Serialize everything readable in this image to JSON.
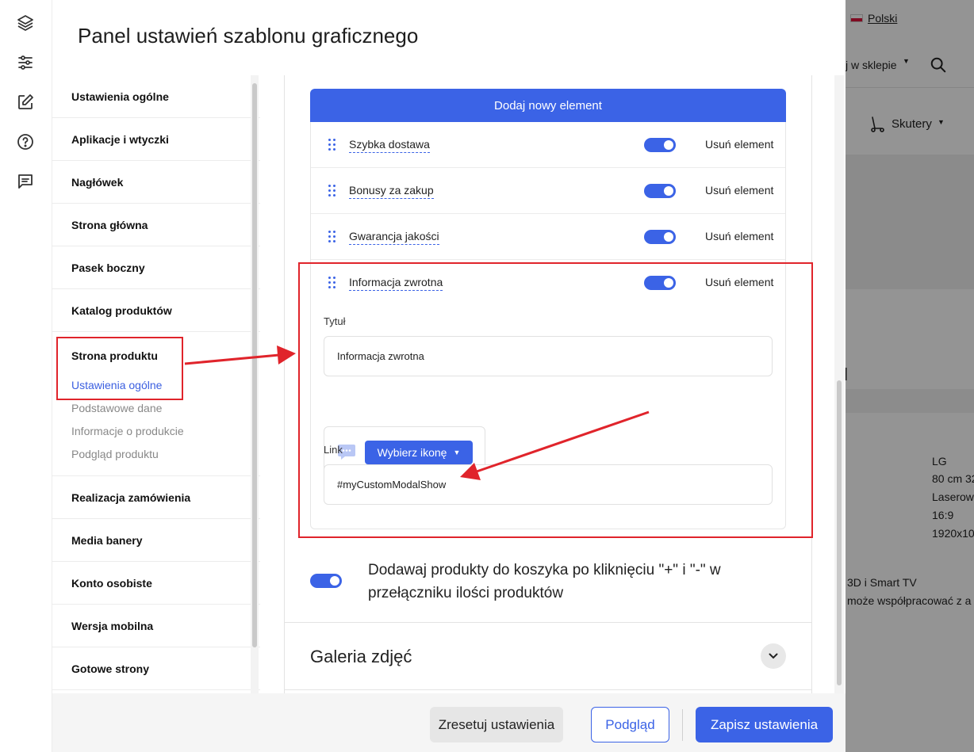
{
  "panel": {
    "title": "Panel ustawień szablonu graficznego"
  },
  "rail_icons": [
    "layers-icon",
    "sliders-icon",
    "edit-icon",
    "help-icon",
    "message-icon"
  ],
  "nav": {
    "items": [
      {
        "label": "Ustawienia ogólne"
      },
      {
        "label": "Aplikacje i wtyczki"
      },
      {
        "label": "Nagłówek"
      },
      {
        "label": "Strona główna"
      },
      {
        "label": "Pasek boczny"
      },
      {
        "label": "Katalog produktów"
      },
      {
        "label": "Strona produktu",
        "children": [
          "Ustawienia ogólne",
          "Podstawowe dane",
          "Informacje o produkcie",
          "Podgląd produktu"
        ],
        "active_child": "Ustawienia ogólne"
      },
      {
        "label": "Realizacja zamówienia"
      },
      {
        "label": "Media banery"
      },
      {
        "label": "Konto osobiste"
      },
      {
        "label": "Wersja mobilna"
      },
      {
        "label": "Gotowe strony"
      }
    ]
  },
  "content": {
    "add_button": "Dodaj nowy element",
    "remove_label": "Usuń element",
    "elements": [
      {
        "name": "Szybka dostawa",
        "enabled": true
      },
      {
        "name": "Bonusy za zakup",
        "enabled": true
      },
      {
        "name": "Gwarancja jakości",
        "enabled": true
      },
      {
        "name": "Informacja zwrotna",
        "enabled": true
      }
    ],
    "form": {
      "title_label": "Tytuł",
      "title_value": "Informacja zwrotna",
      "icon": "chat-bubble-icon",
      "choose_icon_button": "Wybierz ikonę",
      "link_label": "Link",
      "link_value": "#myCustomModalShow"
    },
    "option": {
      "text": "Dodawaj produkty do koszyka po kliknięciu \"+\" i \"-\" w przełączniku ilości produktów",
      "enabled": true
    },
    "gallery": {
      "title": "Galeria zdjęć"
    }
  },
  "footer": {
    "reset": "Zresetuj ustawienia",
    "preview": "Podgląd",
    "save": "Zapisz ustawienia"
  },
  "backdrop": {
    "language": "Polski",
    "search_scope": "j w sklepie",
    "category": "Skutery",
    "spec_values": [
      "LG",
      "80 cm 32",
      "Laserowy",
      "16:9",
      "1920x10"
    ],
    "text1": "3D i Smart TV",
    "text2": "może współpracować z a",
    "heading_fragment": "l"
  },
  "colors": {
    "accent": "#3b63e6",
    "annotation": "#e0242b"
  }
}
